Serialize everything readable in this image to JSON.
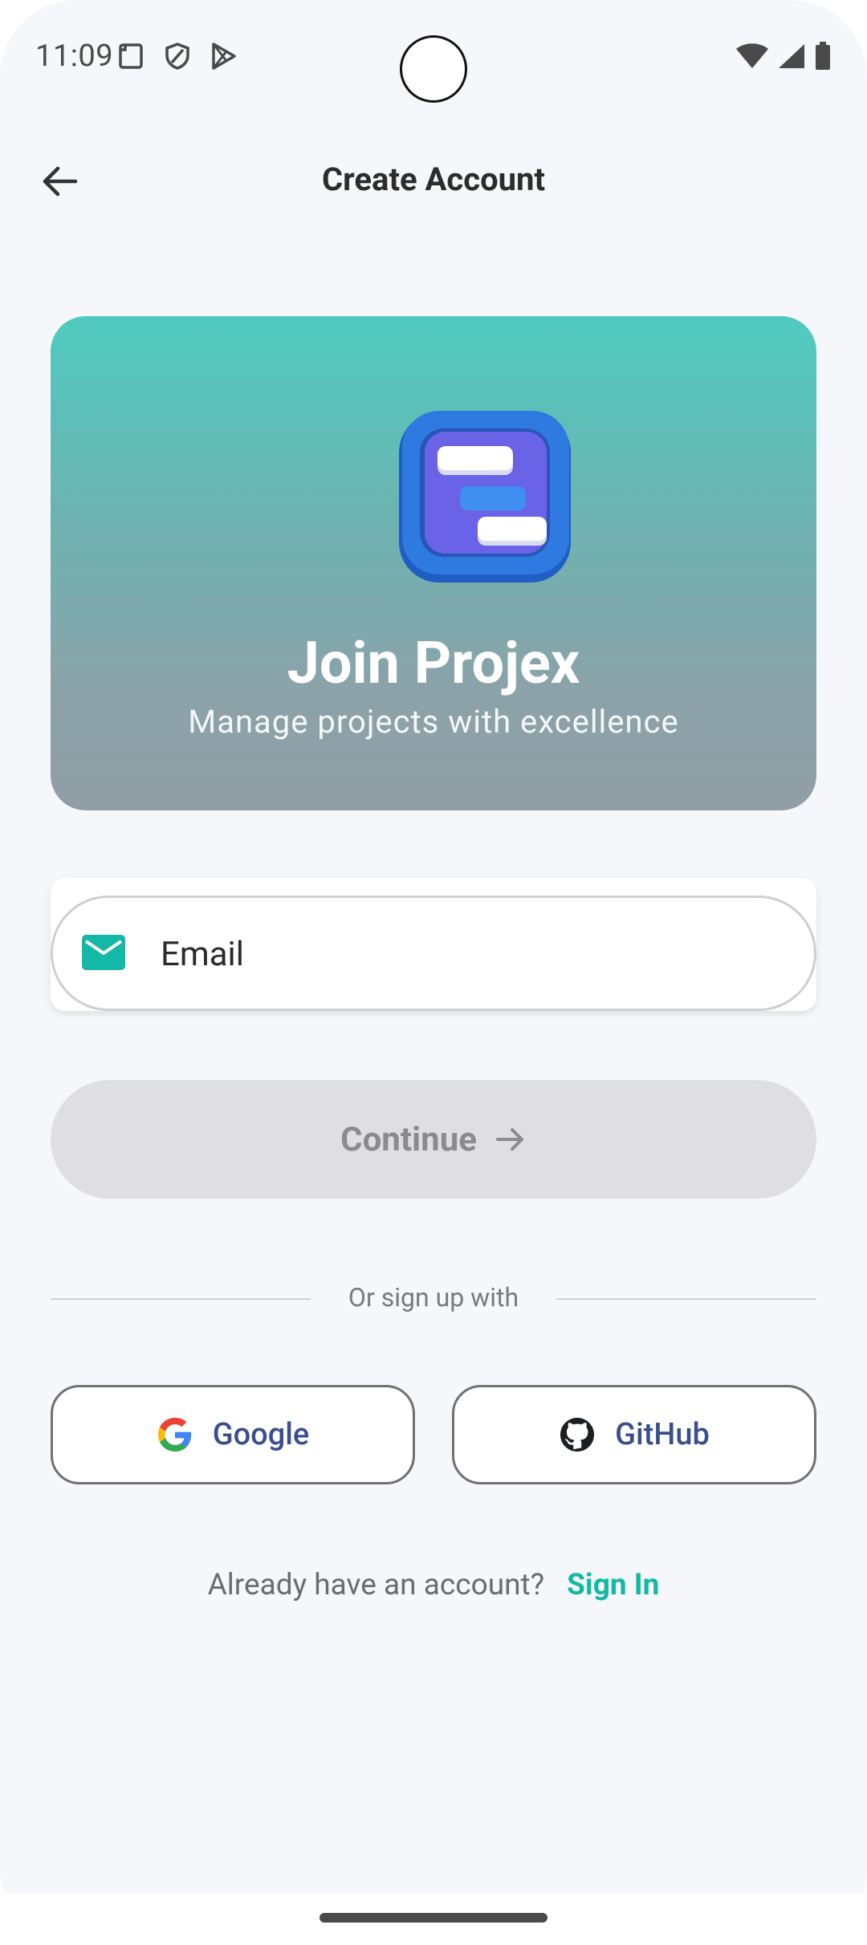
{
  "status_bar": {
    "time": "11:09",
    "left_icons": [
      "screenshot-icon",
      "shield-icon",
      "play-store-icon"
    ],
    "right_icons": [
      "wifi-icon",
      "signal-icon",
      "battery-icon"
    ]
  },
  "app_bar": {
    "back_icon": "arrow-left-icon",
    "title": "Create Account"
  },
  "hero": {
    "logo_icon": "projex-app-logo",
    "title": "Join Projex",
    "subtitle": "Manage projects with excellence",
    "gradient_top": "#4fcbbf",
    "gradient_bottom": "#929ea6"
  },
  "form": {
    "email_icon": "mail-icon",
    "email_label": "Email",
    "email_value": "",
    "continue_label": "Continue",
    "continue_icon": "arrow-right-icon",
    "continue_enabled": false
  },
  "divider": {
    "text": "Or sign up with"
  },
  "social": [
    {
      "label": "Google",
      "icon": "google-icon"
    },
    {
      "label": "GitHub",
      "icon": "github-icon"
    }
  ],
  "footer": {
    "prompt": "Already have an account?",
    "link": "Sign In"
  },
  "colors": {
    "accent": "#14b8a6",
    "social_text": "#3a4d8f",
    "background": "#f6f7fa"
  }
}
